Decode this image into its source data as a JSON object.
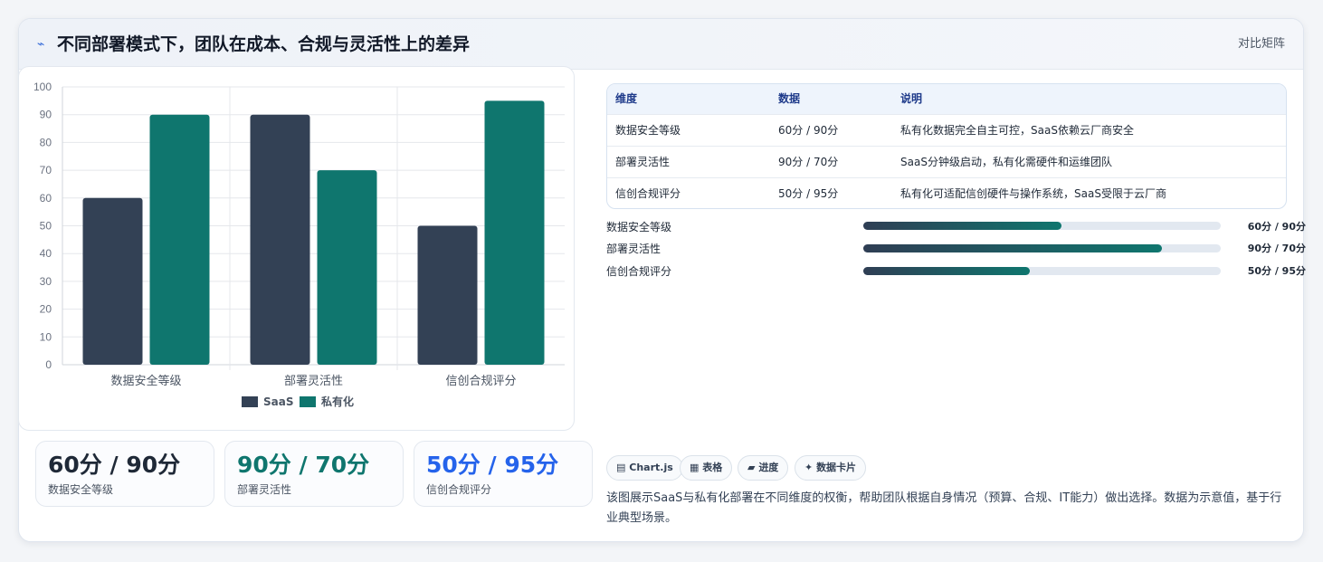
{
  "header": {
    "title": "不同部署模式下，团队在成本、合规与灵活性上的差异",
    "right_label": "对比矩阵"
  },
  "chart_data": {
    "type": "bar",
    "categories": [
      "数据安全等级",
      "部署灵活性",
      "信创合规评分"
    ],
    "series": [
      {
        "name": "SaaS",
        "values": [
          60,
          90,
          50
        ],
        "color": "#334155"
      },
      {
        "name": "私有化",
        "values": [
          90,
          70,
          95
        ],
        "color": "#0f766e"
      }
    ],
    "ylim": [
      0,
      100
    ],
    "yticks": [
      0,
      10,
      20,
      30,
      40,
      50,
      60,
      70,
      80,
      90,
      100
    ],
    "legend": "bottom",
    "grid": true
  },
  "stats": [
    {
      "value": "60分 / 90分",
      "label": "数据安全等级",
      "color": "#1f2937"
    },
    {
      "value": "90分 / 70分",
      "label": "部署灵活性",
      "color": "#0f766e"
    },
    {
      "value": "50分 / 95分",
      "label": "信创合规评分",
      "color": "#2563eb"
    }
  ],
  "table": {
    "headers": [
      "维度",
      "数据",
      "说明"
    ],
    "rows": [
      [
        "数据安全等级",
        "60分 / 90分",
        "私有化数据完全自主可控，SaaS依赖云厂商安全"
      ],
      [
        "部署灵活性",
        "90分 / 70分",
        "SaaS分钟级启动，私有化需硬件和运维团队"
      ],
      [
        "信创合规评分",
        "50分 / 95分",
        "私有化可适配信创硬件与操作系统，SaaS受限于云厂商"
      ]
    ]
  },
  "progress": [
    {
      "label": "数据安全等级",
      "value": "60分 / 90分",
      "fraction": 0.555
    },
    {
      "label": "部署灵活性",
      "value": "90分 / 70分",
      "fraction": 0.835
    },
    {
      "label": "信创合规评分",
      "value": "50分 / 95分",
      "fraction": 0.465
    }
  ],
  "chips": [
    {
      "icon": "▤",
      "label": "Chart.js"
    },
    {
      "icon": "▦",
      "label": "表格"
    },
    {
      "icon": "▰",
      "label": "进度"
    },
    {
      "icon": "✦",
      "label": "数据卡片"
    }
  ],
  "description": "该图展示SaaS与私有化部署在不同维度的权衡，帮助团队根据自身情况（预算、合规、IT能力）做出选择。数据为示意值，基于行业典型场景。"
}
